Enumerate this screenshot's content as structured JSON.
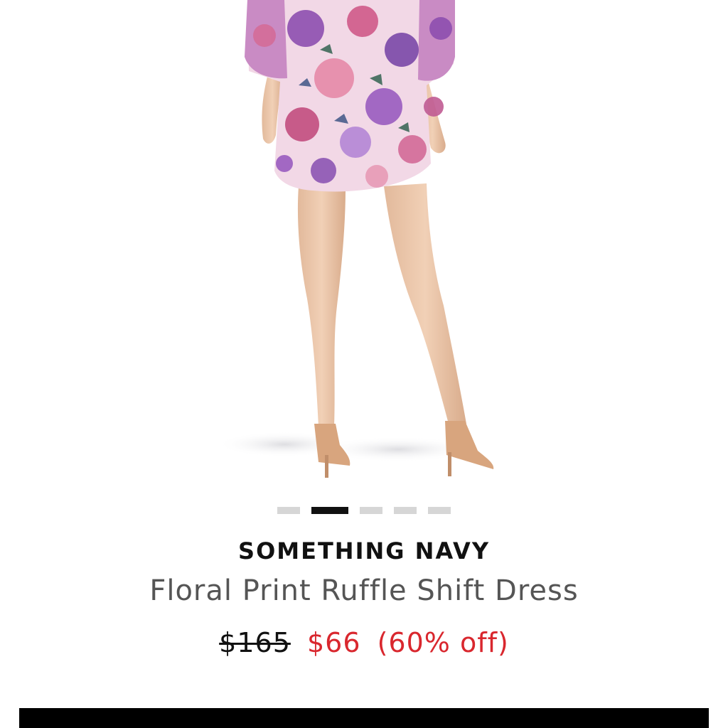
{
  "product": {
    "brand": "SOMETHING NAVY",
    "name": "Floral Print Ruffle Shift Dress",
    "price_original": "$165",
    "price_sale": "$66",
    "discount": "(60% off)"
  },
  "carousel": {
    "total_images": 5,
    "active_index": 1
  },
  "colors": {
    "sale_red": "#d9272e",
    "text_dark": "#111111",
    "text_gray": "#555555",
    "dot_inactive": "#d6d6d6",
    "dot_active": "#111111"
  }
}
